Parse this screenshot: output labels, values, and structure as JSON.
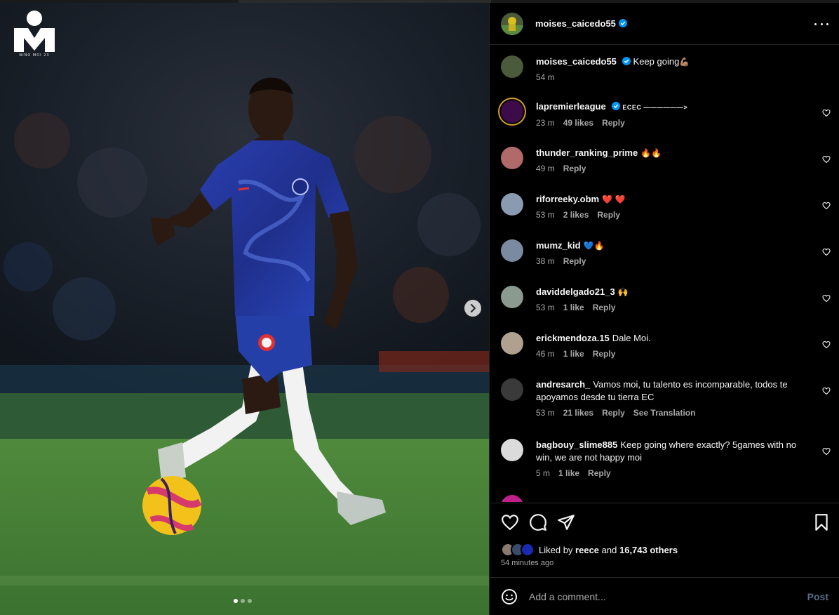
{
  "logo": {
    "caption": "NIÑO MOI 23"
  },
  "carousel": {
    "slides": 3,
    "active": 1
  },
  "post": {
    "author": "moises_caicedo55",
    "author_verified": true
  },
  "comments": [
    {
      "user": "moises_caicedo55",
      "verified": true,
      "text": "Keep going",
      "emoji": "💪🏽",
      "time": "54 m",
      "likes": "",
      "reply": "",
      "translate": "",
      "heart": false,
      "avatar_color": "#4a5a3a"
    },
    {
      "user": "lapremierleague",
      "verified": true,
      "text": "ECEC ——————>",
      "emoji": "",
      "time": "23 m",
      "likes": "49 likes",
      "reply": "Reply",
      "translate": "",
      "heart": true,
      "avatar_color": "#3d0a4a"
    },
    {
      "user": "thunder_ranking_prime",
      "verified": false,
      "text": "",
      "emoji": "🔥🔥",
      "time": "49 m",
      "likes": "",
      "reply": "Reply",
      "translate": "",
      "heart": true,
      "avatar_color": "#b06a6a"
    },
    {
      "user": "riforreeky.obm",
      "verified": false,
      "text": "",
      "emoji": "❤️ ❤️",
      "time": "53 m",
      "likes": "2 likes",
      "reply": "Reply",
      "translate": "",
      "heart": true,
      "avatar_color": "#8a9ab0"
    },
    {
      "user": "mumz_kid",
      "verified": false,
      "text": "",
      "emoji": "💙🔥",
      "time": "38 m",
      "likes": "",
      "reply": "Reply",
      "translate": "",
      "heart": true,
      "avatar_color": "#7a8aa0"
    },
    {
      "user": "daviddelgado21_3",
      "verified": false,
      "text": "",
      "emoji": "🙌",
      "time": "53 m",
      "likes": "1 like",
      "reply": "Reply",
      "translate": "",
      "heart": true,
      "avatar_color": "#8a9a90"
    },
    {
      "user": "erickmendoza.15",
      "verified": false,
      "text": "Dale Moi.",
      "emoji": "",
      "time": "46 m",
      "likes": "1 like",
      "reply": "Reply",
      "translate": "",
      "heart": true,
      "avatar_color": "#b0a090"
    },
    {
      "user": "andresarch_",
      "verified": false,
      "text": "Vamos moi, tu talento es incomparable, todos te apoyamos desde tu tierra EC",
      "emoji": "",
      "time": "53 m",
      "likes": "21 likes",
      "reply": "Reply",
      "translate": "See Translation",
      "heart": true,
      "avatar_color": "#3a3a3a"
    },
    {
      "user": "bagbouy_slime885",
      "verified": false,
      "text": "Keep going where exactly? 5games with no win, we are not happy moi",
      "emoji": "",
      "time": "5 m",
      "likes": "1 like",
      "reply": "Reply",
      "translate": "",
      "heart": true,
      "avatar_color": "#dbdbdb"
    },
    {
      "user": "..............",
      "verified": false,
      "text": "",
      "emoji": "",
      "time": "",
      "likes": "",
      "reply": "",
      "translate": "",
      "heart": false,
      "avatar_color": "#c0208a"
    }
  ],
  "liked_by": {
    "prefix": "Liked by",
    "user": "reece",
    "and": "and",
    "others": "16,743 others"
  },
  "time_ago": "54 minutes ago",
  "composer": {
    "placeholder": "Add a comment...",
    "post_label": "Post"
  },
  "colors": {
    "verified": "#0095f6",
    "post_disabled": "#5a6b8c"
  },
  "icons": [
    "heart-icon",
    "comment-icon",
    "share-icon",
    "bookmark-icon",
    "emoji-icon",
    "more-icon",
    "chevron-right-icon"
  ]
}
